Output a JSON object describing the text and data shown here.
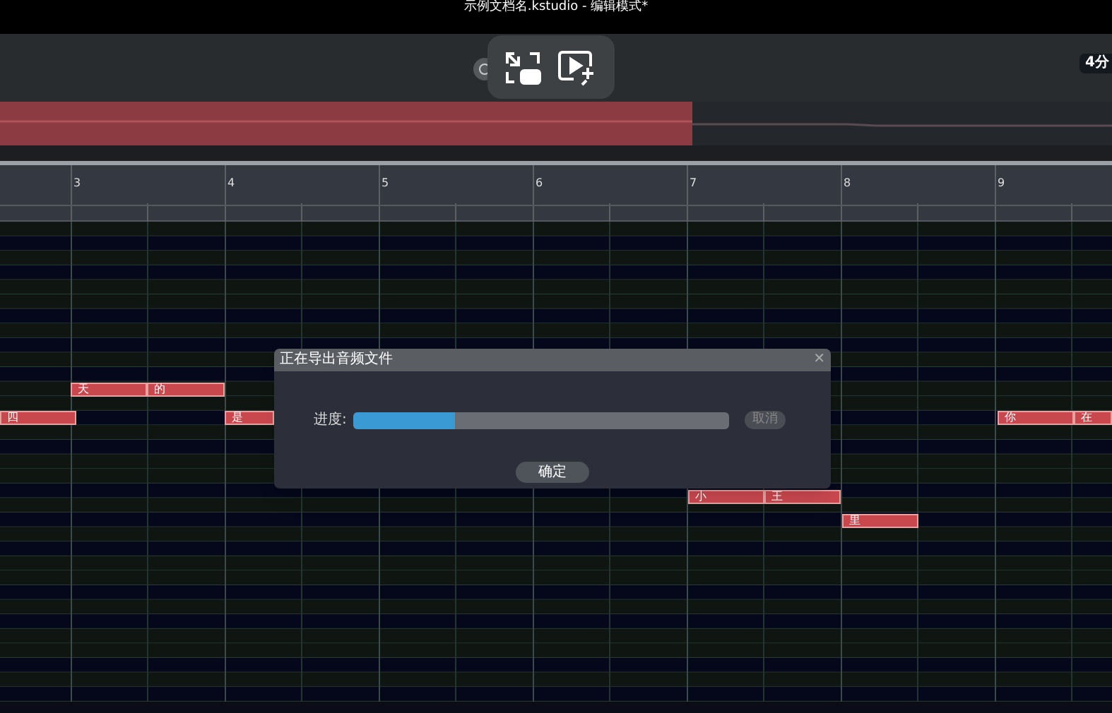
{
  "window": {
    "title": "示例文档名.kstudio - 编辑模式*"
  },
  "toolbar": {
    "badge": "4分"
  },
  "ruler": {
    "bars": [
      "3",
      "4",
      "5",
      "6",
      "7",
      "8",
      "9"
    ]
  },
  "notes": [
    {
      "lyric": "天"
    },
    {
      "lyric": "的"
    },
    {
      "lyric": "四"
    },
    {
      "lyric": "是"
    },
    {
      "lyric": "你"
    },
    {
      "lyric": "在"
    },
    {
      "lyric": "小"
    },
    {
      "lyric": "王"
    },
    {
      "lyric": "里"
    }
  ],
  "dialog": {
    "title": "正在导出音频文件",
    "close": "✕",
    "label": "进度:",
    "progress": {
      "level": 0.27
    },
    "cancel": {
      "label": "取消",
      "disabled": true
    },
    "ok": {
      "label": "确定"
    }
  }
}
